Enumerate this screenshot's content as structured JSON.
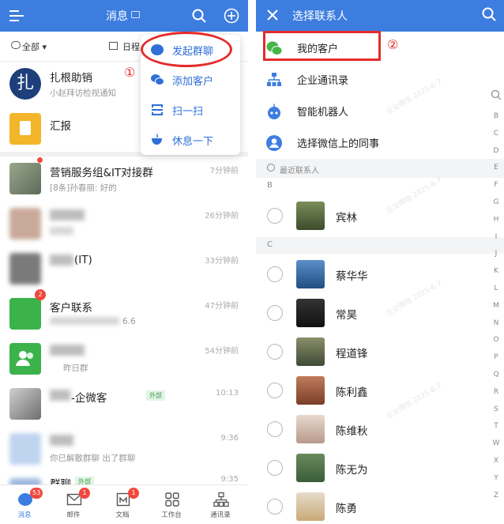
{
  "left": {
    "header_title": "消息",
    "filter": {
      "all_label": "全部",
      "schedule_label": "日程"
    },
    "menu": {
      "items": [
        {
          "label": "发起群聊"
        },
        {
          "label": "添加客户"
        },
        {
          "label": "扫一扫"
        },
        {
          "label": "休息一下"
        }
      ],
      "marker": "①"
    },
    "chats": [
      {
        "name": "扎根助销",
        "sub": "小赵拜访检视通知",
        "time": ""
      },
      {
        "name": "汇报",
        "sub": "",
        "time": ""
      },
      {
        "name": "营销服务组&IT对接群",
        "sub": "[8条]孙春丽: 好的",
        "time": "7分钟前"
      },
      {
        "name": "",
        "sub": "",
        "time": "26分钟前"
      },
      {
        "name": "(IT)",
        "sub": "",
        "time": "33分钟前"
      },
      {
        "name": "客户联系",
        "sub": "6.6",
        "time": "47分钟前",
        "badge": "2"
      },
      {
        "name": "",
        "sub": "昨日群",
        "time": "54分钟前"
      },
      {
        "name": "-企微客",
        "sub": "",
        "time": "10:13",
        "tag": "外部"
      },
      {
        "name": "",
        "sub": "你已解散群聊 出了群聊",
        "time": "9:36"
      },
      {
        "name": "群聊",
        "sub": "",
        "time": "9:35",
        "tag": "外部"
      }
    ],
    "tabs": [
      {
        "label": "消息",
        "badge": "53"
      },
      {
        "label": "邮件",
        "badge": "1"
      },
      {
        "label": "文档",
        "badge": "1"
      },
      {
        "label": "工作台",
        "badge": ""
      },
      {
        "label": "通讯录",
        "badge": ""
      }
    ]
  },
  "right": {
    "header_title": "选择联系人",
    "top_items": [
      {
        "label": "我的客户"
      },
      {
        "label": "企业通讯录"
      },
      {
        "label": "智能机器人"
      },
      {
        "label": "选择微信上的同事"
      }
    ],
    "marker": "②",
    "recent_label": "最近联系人",
    "sections": [
      {
        "letter": "B",
        "contacts": [
          "宾林"
        ]
      },
      {
        "letter": "C",
        "contacts": [
          "蔡华华",
          "常昊",
          "程道锋",
          "陈利鑫",
          "陈维秋",
          "陈无为",
          "陈勇"
        ]
      }
    ],
    "index_letters": [
      "B",
      "C",
      "D",
      "E",
      "F",
      "G",
      "H",
      "I",
      "J",
      "K",
      "L",
      "M",
      "N",
      "O",
      "P",
      "Q",
      "R",
      "S",
      "T",
      "W",
      "X",
      "Y",
      "Z"
    ]
  },
  "colors": {
    "accent": "#3d7de0",
    "highlight": "#e52b2b",
    "badge": "#f1483d"
  }
}
